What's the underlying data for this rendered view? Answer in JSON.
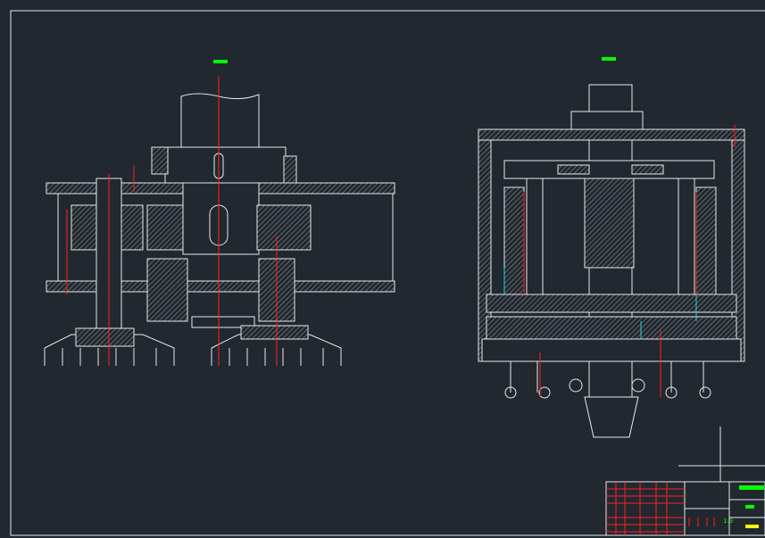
{
  "drawing": {
    "scale": "1:3",
    "colors": {
      "background": "#212830",
      "lines": "#e8e8e8",
      "centerlines": "#ff2020",
      "labels": "#00ff00",
      "drawing_no": "#ffff00"
    }
  }
}
